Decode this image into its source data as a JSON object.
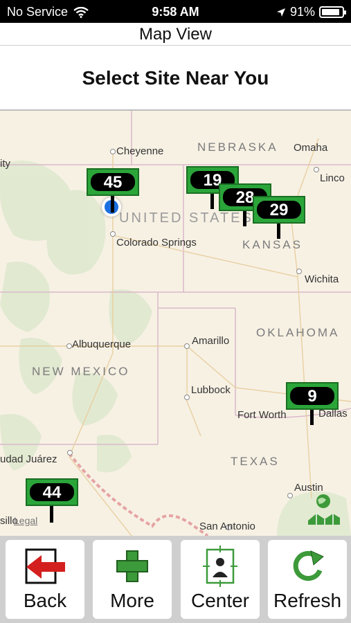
{
  "status_bar": {
    "carrier": "No Service",
    "time": "9:58 AM",
    "battery": "91%",
    "battery_level": 0.91
  },
  "nav": {
    "title": "Map View"
  },
  "heading": "Select Site Near You",
  "map": {
    "states": [
      "NEBRASKA",
      "UNITED STATES",
      "KANSAS",
      "OKLAHOMA",
      "NEW MEXICO",
      "TEXAS"
    ],
    "cities": [
      "ity",
      "Cheyenne",
      "Omaha",
      "Linco",
      "Colorado Springs",
      "Wichita",
      "Albuquerque",
      "Amarillo",
      "Lubbock",
      "Fort Worth",
      "Dallas",
      "udad Juárez",
      "Austin",
      "sillo",
      "San Antonio"
    ],
    "legal": "Legal",
    "markers": [
      "45",
      "19",
      "28",
      "29",
      "9",
      "44"
    ]
  },
  "toolbar": {
    "back_label": "Back",
    "more_label": "More",
    "center_label": "Center",
    "refresh_label": "Refresh"
  },
  "colors": {
    "marker_green": "#2ba53a",
    "user_location": "#1b6fe0",
    "back_arrow": "#d41f1f",
    "plus_green": "#3d9a3a"
  }
}
